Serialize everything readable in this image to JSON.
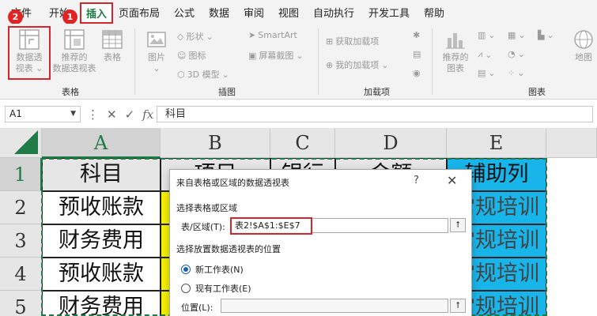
{
  "ribbon_tabs": [
    "文件",
    "开始",
    "插入",
    "页面布局",
    "公式",
    "数据",
    "审阅",
    "视图",
    "自动执行",
    "开发工具",
    "帮助"
  ],
  "badges": {
    "one": "1",
    "two": "2"
  },
  "ribbon": {
    "table_group": {
      "pivot_label_1": "数据透",
      "pivot_label_2": "视表",
      "recommended_label_1": "推荐的",
      "recommended_label_2": "数据透视表",
      "table_label": "表格",
      "group_label": "表格"
    },
    "illustrations": {
      "picture_label": "图片",
      "shapes": "形状",
      "icons": "图标",
      "model3d": "3D 模型",
      "smartart": "SmartArt",
      "screenshot": "屏幕截图",
      "group_label": "插图"
    },
    "addins": {
      "get": "获取加载项",
      "my": "我的加载项",
      "group_label": "加载项"
    },
    "charts": {
      "recommended_1": "推荐的",
      "recommended_2": "图表",
      "map_label": "地图",
      "group_label": "图表"
    }
  },
  "formula_bar": {
    "name_box": "A1",
    "cancel": "✕",
    "enter": "✓",
    "fx": "fx",
    "content": "科目"
  },
  "columns": [
    "A",
    "B",
    "C",
    "D",
    "E"
  ],
  "rows": [
    "1",
    "2",
    "3",
    "4",
    "5"
  ],
  "cells": {
    "a1": "科目",
    "b1": "项目",
    "c1": "银行",
    "d1": "金额",
    "e1": "辅助列",
    "a2": "预收账款",
    "a3": "财务费用",
    "a4": "预收账款",
    "a5": "财务费用",
    "e2": "常规培训",
    "e3": "常规培训",
    "e4": "常规培训",
    "e5": "常规培训"
  },
  "dialog": {
    "title": "来自表格或区域的数据透视表",
    "help": "?",
    "close": "✕",
    "section1": "选择表格或区域",
    "range_label": "表/区域(T):",
    "range_value": "表2!$A$1:$E$7",
    "section2": "选择放置数据透视表的位置",
    "opt_new": "新工作表(N)",
    "opt_existing": "现有工作表(E)",
    "location_label": "位置(L):",
    "location_value": "",
    "collapse_icon": "⭡"
  },
  "colors": {
    "accent": "#1e7b45",
    "highlight": "#d6262b",
    "aux_fill": "#18b5ea",
    "yellow_fill": "#f6f000"
  }
}
